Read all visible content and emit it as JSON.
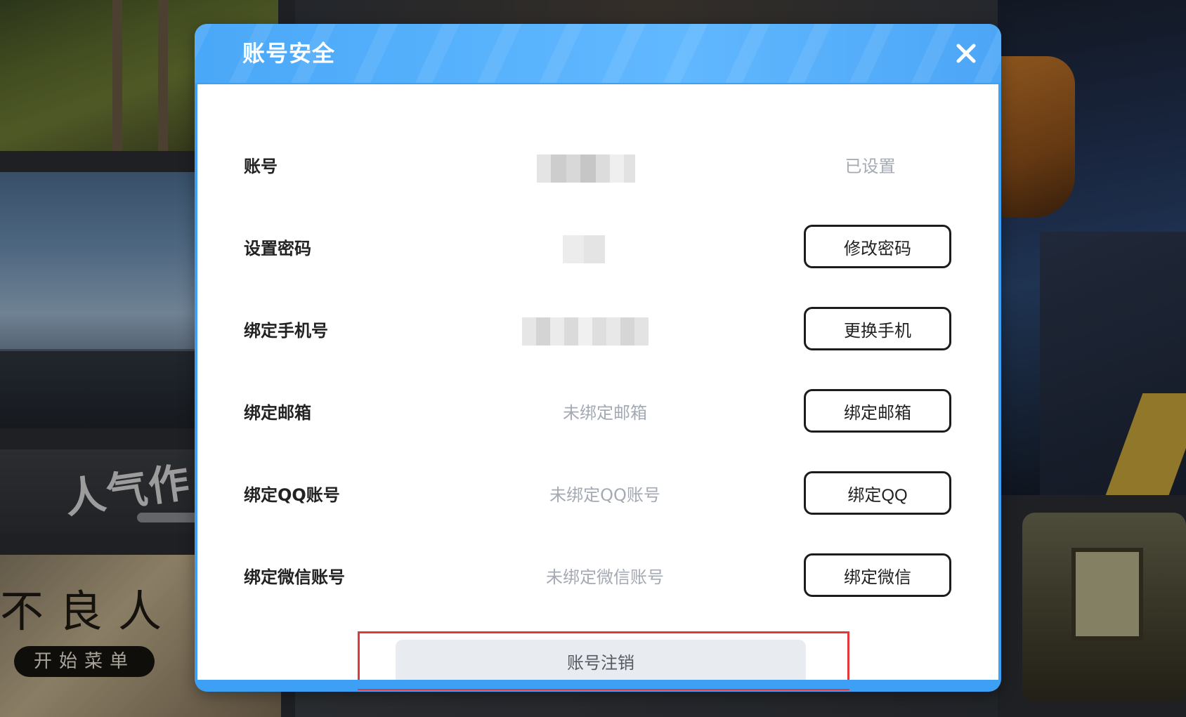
{
  "background": {
    "popular_text": "人气作",
    "game_title": "不良人",
    "game_start": "开始菜单"
  },
  "dialog": {
    "title": "账号安全",
    "close_icon": "close-icon"
  },
  "rows": [
    {
      "label": "账号",
      "value": "",
      "value_masked": true,
      "status": "已设置",
      "button": null
    },
    {
      "label": "设置密码",
      "value": "",
      "value_masked": true,
      "status": null,
      "button": "修改密码"
    },
    {
      "label": "绑定手机号",
      "value": "",
      "value_masked": true,
      "status": null,
      "button": "更换手机"
    },
    {
      "label": "绑定邮箱",
      "value": "未绑定邮箱",
      "value_masked": false,
      "status": null,
      "button": "绑定邮箱"
    },
    {
      "label": "绑定QQ账号",
      "value": "未绑定QQ账号",
      "value_masked": false,
      "status": null,
      "button": "绑定QQ"
    },
    {
      "label": "绑定微信账号",
      "value": "未绑定微信账号",
      "value_masked": false,
      "status": null,
      "button": "绑定微信"
    }
  ],
  "footer": {
    "cancel_account_label": "账号注销"
  },
  "colors": {
    "header_blue": "#4aa8f8",
    "highlight_red": "#e0383c",
    "muted_text": "#a4aab3"
  }
}
